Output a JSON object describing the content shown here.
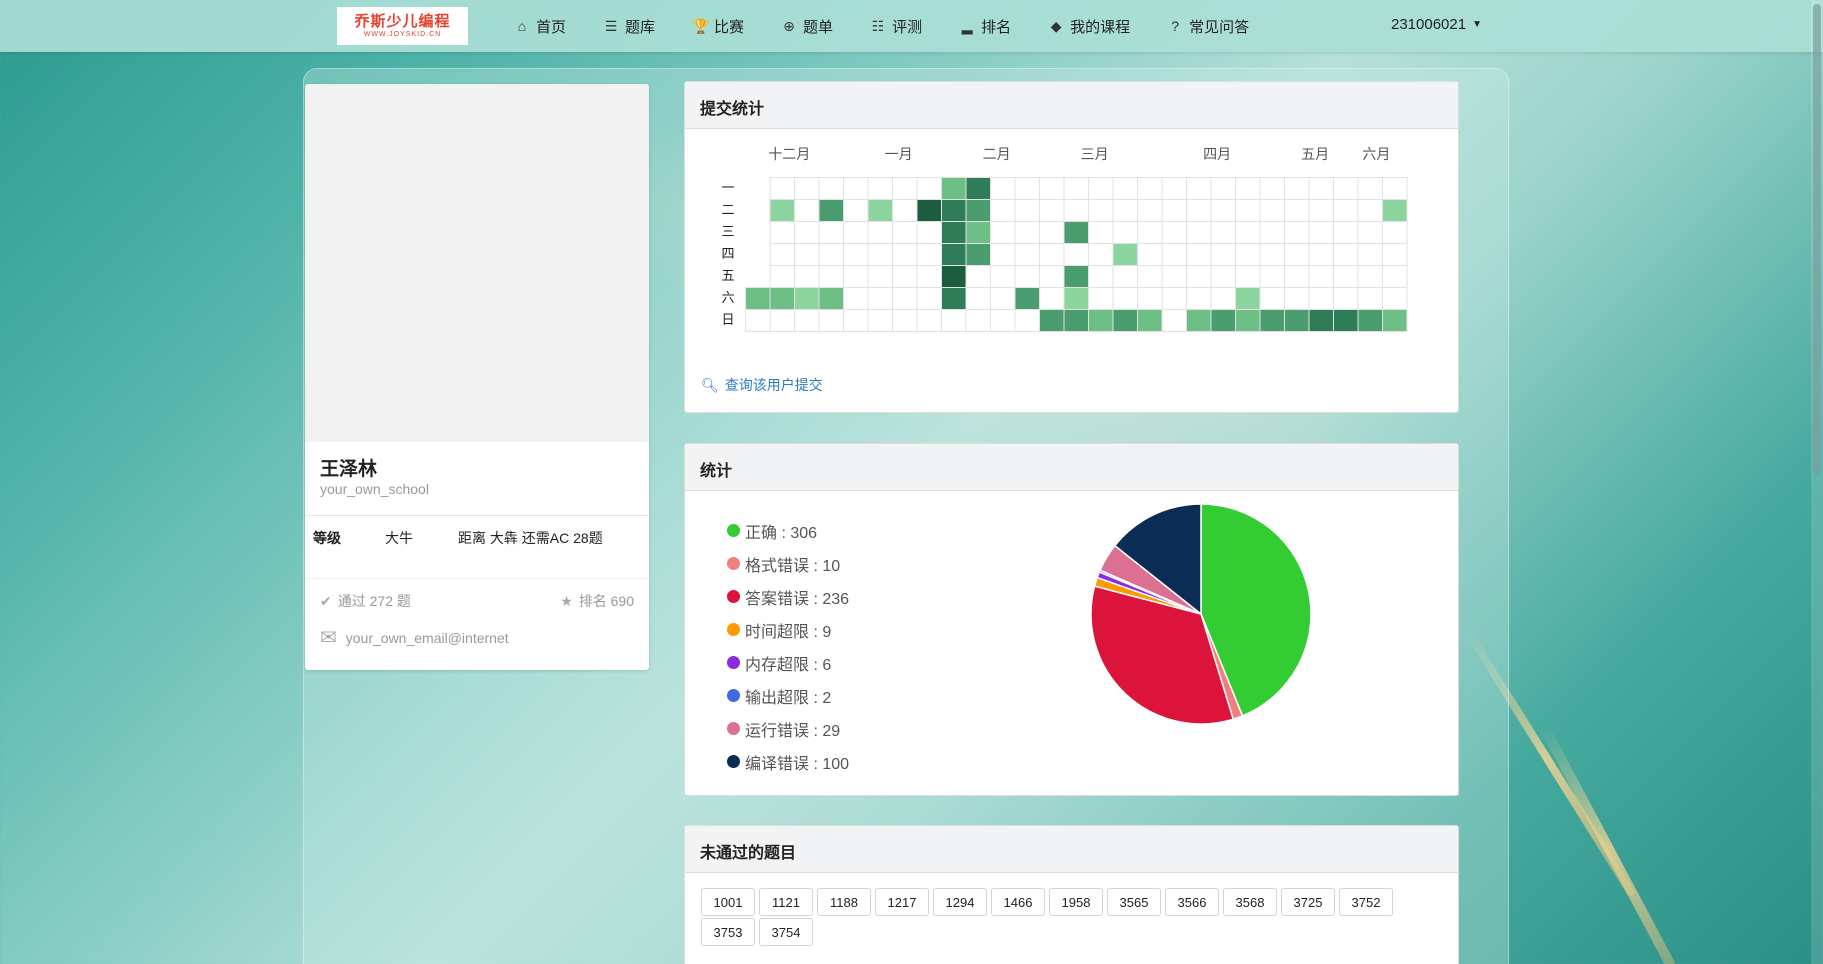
{
  "nav": {
    "logo_main": "乔斯少儿编程",
    "logo_sub": "WWW.JOYSKID.CN",
    "items": [
      {
        "icon": "home-icon",
        "glyph": "⌂",
        "label": "首页"
      },
      {
        "icon": "list-icon",
        "glyph": "☰",
        "label": "题库"
      },
      {
        "icon": "trophy-icon",
        "glyph": "🏆",
        "label": "比赛"
      },
      {
        "icon": "globe-icon",
        "glyph": "⊕",
        "label": "题单"
      },
      {
        "icon": "tasks-icon",
        "glyph": "☷",
        "label": "评测"
      },
      {
        "icon": "signal-icon",
        "glyph": "▂",
        "label": "排名"
      },
      {
        "icon": "cube-icon",
        "glyph": "◆",
        "label": "我的课程"
      },
      {
        "icon": "question-icon",
        "glyph": "?",
        "label": "常见问答"
      }
    ],
    "username": "231006021"
  },
  "profile": {
    "name": "王泽林",
    "school": "your_own_school",
    "level_label": "等级",
    "level_value": "大牛",
    "next_level": "距离 大犇 还需AC 28题",
    "passed": "通过 272 题",
    "rank": "排名 690",
    "email": "your_own_email@internet"
  },
  "submit_panel": {
    "title": "提交统计",
    "months": [
      "十二月",
      "一月",
      "二月",
      "三月",
      "四月",
      "五月",
      "六月"
    ],
    "weekdays": [
      "一",
      "二",
      "三",
      "四",
      "五",
      "六",
      "日"
    ],
    "query_link": "查询该用户提交",
    "colors": {
      "empty": "#ffffff",
      "l1": "#8cd59e",
      "l2": "#6dbf86",
      "l3": "#4a9d6e",
      "l4": "#2e7d58",
      "l5": "#1c5c3f"
    },
    "cells": [
      [
        0,
        0,
        0,
        0,
        0,
        0,
        0,
        0,
        2,
        4,
        0,
        0,
        0,
        0,
        0,
        0,
        0,
        0,
        0,
        0,
        0,
        0,
        0,
        0,
        0,
        0,
        0
      ],
      [
        0,
        1,
        0,
        3,
        0,
        1,
        0,
        5,
        4,
        3,
        0,
        0,
        0,
        0,
        0,
        0,
        0,
        0,
        0,
        0,
        0,
        0,
        0,
        0,
        0,
        0,
        1
      ],
      [
        0,
        0,
        0,
        0,
        0,
        0,
        0,
        0,
        4,
        2,
        0,
        0,
        0,
        3,
        0,
        0,
        0,
        0,
        0,
        0,
        0,
        0,
        0,
        0,
        0,
        0,
        0
      ],
      [
        0,
        0,
        0,
        0,
        0,
        0,
        0,
        0,
        4,
        3,
        0,
        0,
        0,
        0,
        0,
        1,
        0,
        0,
        0,
        0,
        0,
        0,
        0,
        0,
        0,
        0,
        0
      ],
      [
        0,
        0,
        0,
        0,
        0,
        0,
        0,
        0,
        5,
        0,
        0,
        0,
        0,
        3,
        0,
        0,
        0,
        0,
        0,
        0,
        0,
        0,
        0,
        0,
        0,
        0,
        0
      ],
      [
        2,
        2,
        1,
        2,
        0,
        0,
        0,
        0,
        4,
        0,
        0,
        3,
        0,
        1,
        0,
        0,
        0,
        0,
        0,
        0,
        1,
        0,
        0,
        0,
        0,
        0,
        0
      ],
      [
        0,
        0,
        0,
        0,
        0,
        0,
        0,
        0,
        0,
        0,
        0,
        0,
        3,
        3,
        2,
        3,
        2,
        0,
        2,
        3,
        2,
        3,
        3,
        4,
        4,
        3,
        2
      ]
    ]
  },
  "stats_panel": {
    "title": "统计",
    "items": [
      {
        "label": "正确",
        "value": 306,
        "color": "#33cc33"
      },
      {
        "label": "格式错误",
        "value": 10,
        "color": "#f08080"
      },
      {
        "label": "答案错误",
        "value": 236,
        "color": "#dc143c"
      },
      {
        "label": "时间超限",
        "value": 9,
        "color": "#ff9900"
      },
      {
        "label": "内存超限",
        "value": 6,
        "color": "#8a2be2"
      },
      {
        "label": "输出超限",
        "value": 2,
        "color": "#4169e1"
      },
      {
        "label": "运行错误",
        "value": 29,
        "color": "#db7093"
      },
      {
        "label": "编译错误",
        "value": 100,
        "color": "#0b2c54"
      }
    ]
  },
  "failed_panel": {
    "title": "未通过的题目",
    "problems": [
      "1001",
      "1121",
      "1188",
      "1217",
      "1294",
      "1466",
      "1958",
      "3565",
      "3566",
      "3568",
      "3725",
      "3752",
      "3753",
      "3754"
    ]
  }
}
